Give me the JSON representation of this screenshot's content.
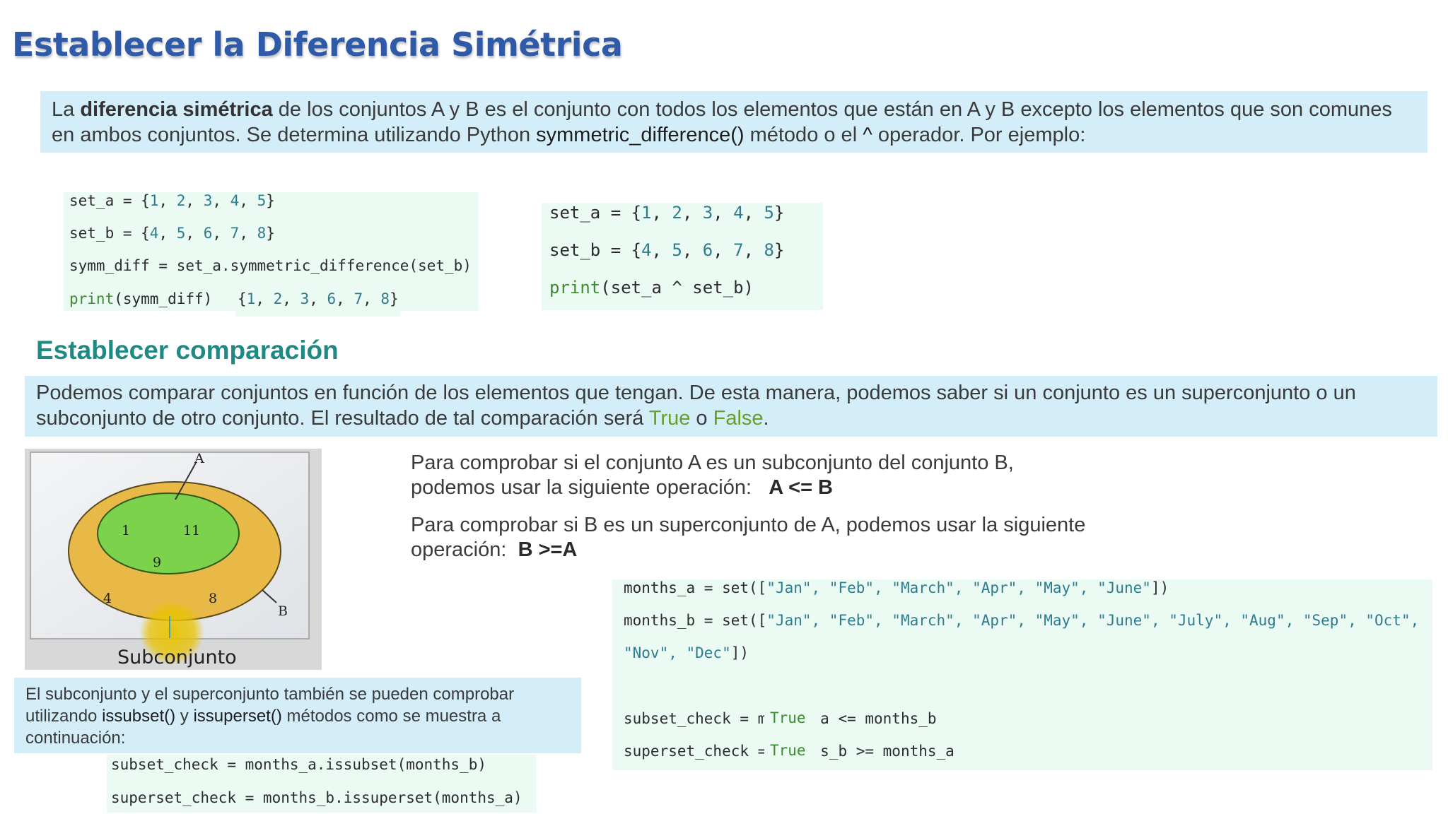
{
  "title": "Establecer la Diferencia Simétrica",
  "intro": {
    "t1": "La ",
    "bold": "diferencia simétrica",
    "t2": " de los conjuntos A y B es el conjunto con todos los elementos que están en A y B excepto los elementos que son comunes en ambos conjuntos. Se determina utilizando Python ",
    "method": "symmetric_difference()",
    "t3": " método o el ",
    "caret": "^",
    "t4": " operador. Por ejemplo:"
  },
  "code1": {
    "l1a": "set_a = {",
    "n1": "1",
    "n2": "2",
    "n3": "3",
    "n4": "4",
    "n5": "5",
    "l1z": "}",
    "l2a": "set_b = {",
    "m1": "4",
    "m2": "5",
    "m3": "6",
    "m4": "7",
    "m5": "8",
    "l2z": "}",
    "l3": "symm_diff = set_a.symmetric_difference(set_b)",
    "print_kw": "print",
    "l4": "(symm_diff)",
    "out_open": "{",
    "o1": "1",
    "o2": "2",
    "o3": "3",
    "o4": "6",
    "o5": "7",
    "o6": "8",
    "out_close": "}"
  },
  "code2": {
    "l1a": "set_a = {",
    "n1": "1",
    "n2": "2",
    "n3": "3",
    "n4": "4",
    "n5": "5",
    "l1z": "}",
    "l2a": "set_b = {",
    "m1": "4",
    "m2": "5",
    "m3": "6",
    "m4": "7",
    "m5": "8",
    "l2z": "}",
    "print_kw": "print",
    "l3": "(set_a ^ set_b)"
  },
  "section2": {
    "title": "Establecer comparación",
    "t1": "Podemos comparar conjuntos en función de los elementos que tengan. De esta manera, podemos saber si un conjunto es un superconjunto o un subconjunto de otro conjunto. El resultado de tal comparación será ",
    "true": "True",
    "or": " o ",
    "false": "False",
    "end": "."
  },
  "venn": {
    "label_a": "A",
    "label_b": "B",
    "inner": [
      "1",
      "11",
      "9"
    ],
    "outer": [
      "4",
      "8"
    ],
    "caption": "Subconjunto"
  },
  "para1": {
    "l1": "Para comprobar si el conjunto A es un subconjunto del conjunto B,",
    "l2": "podemos usar la siguiente operación:",
    "op": "A <= B"
  },
  "para2": {
    "l1": "Para comprobar si B es un superconjunto de A, podemos usar la siguiente",
    "l2": "operación:",
    "op": "B >=A"
  },
  "code3": {
    "l1a": "months_a = set([",
    "l1s": "\"Jan\", \"Feb\", \"March\", \"Apr\", \"May\", \"June\"",
    "l1z": "])",
    "l2a": "months_b = set([",
    "l2s": "\"Jan\", \"Feb\", \"March\", \"Apr\", \"May\", \"June\", \"July\", \"Aug\", \"Sep\", \"Oct\",",
    "l3s": "\"Nov\", \"Dec\"",
    "l3z": "])",
    "l4": "subset_check = m",
    "l4b": "a <= months_b",
    "l5": "superset_check =",
    "l5b": "s_b >= months_a",
    "true1": "True",
    "true2": "True"
  },
  "subset_note": {
    "t1": "El subconjunto y el superconjunto también se pueden comprobar utilizando ",
    "m1": "issubset()",
    "t2": " y ",
    "m2": "issuperset()",
    "t3": " métodos como se muestra a continuación:"
  },
  "code4": {
    "l1": "subset_check = months_a.issubset(months_b)",
    "l2": "superset_check = months_b.issuperset(months_a)"
  }
}
